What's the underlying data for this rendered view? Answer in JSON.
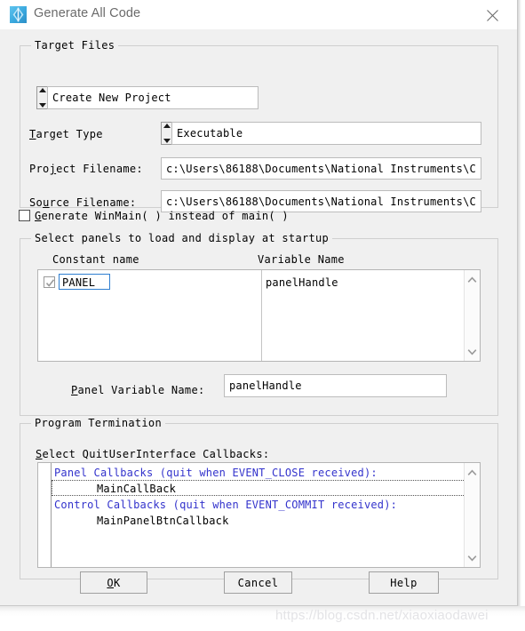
{
  "window": {
    "title": "Generate All Code",
    "icon": "labwindows-cvi-diamond-icon",
    "close_label": "×"
  },
  "target_files": {
    "group_title": "Target Files",
    "project_selector": {
      "value": "Create New Project",
      "spinner_up": "▲",
      "spinner_down": "▼"
    },
    "target_type": {
      "label": "Target Type",
      "mnemonic": "T",
      "value": "Executable"
    },
    "project_filename": {
      "label": "Project Filename:",
      "mnemonic": "j",
      "value": "c:\\Users\\86188\\Documents\\National Instruments\\C"
    },
    "source_filename": {
      "label": "Source Filename:",
      "mnemonic": "u",
      "value": "c:\\Users\\86188\\Documents\\National Instruments\\C"
    }
  },
  "winmain_checkbox": {
    "label": "Generate WinMain( ) instead of main( )",
    "mnemonic": "G",
    "checked": false
  },
  "startup_panels": {
    "group_title": "Select panels to load and display at startup",
    "columns": [
      "Constant name",
      "Variable Name"
    ],
    "rows": [
      {
        "checked": true,
        "constant_name": "PANEL",
        "variable_name": "panelHandle",
        "selected": true
      }
    ],
    "panel_variable_name": {
      "label": "Panel Variable Name:",
      "mnemonic": "P",
      "value": "panelHandle"
    }
  },
  "program_termination": {
    "group_title": "Program Termination",
    "select_label": "Select QuitUserInterface Callbacks:",
    "mnemonic": "S",
    "lines": [
      {
        "text": "Panel Callbacks (quit when EVENT_CLOSE received):",
        "kind": "header",
        "focused": false
      },
      {
        "text": "MainCallBack",
        "kind": "item",
        "focused": true
      },
      {
        "text": "Control Callbacks (quit when EVENT_COMMIT received):",
        "kind": "header",
        "focused": false
      },
      {
        "text": "MainPanelBtnCallback",
        "kind": "item",
        "focused": false
      }
    ]
  },
  "buttons": {
    "ok": "OK",
    "ok_mnemonic": "O",
    "cancel": "Cancel",
    "help": "Help"
  },
  "watermark": "https://blog.csdn.net/xiaoxiaodawei",
  "colors": {
    "dialog_bg": "#f0f0f0",
    "titlebar_bg": "#ffffff",
    "title_text": "#6b6b6b",
    "callback_header": "#3333cc",
    "selection_border": "#2f7fd1",
    "field_bg": "#ffffff",
    "group_border": "#cfcfcf"
  }
}
